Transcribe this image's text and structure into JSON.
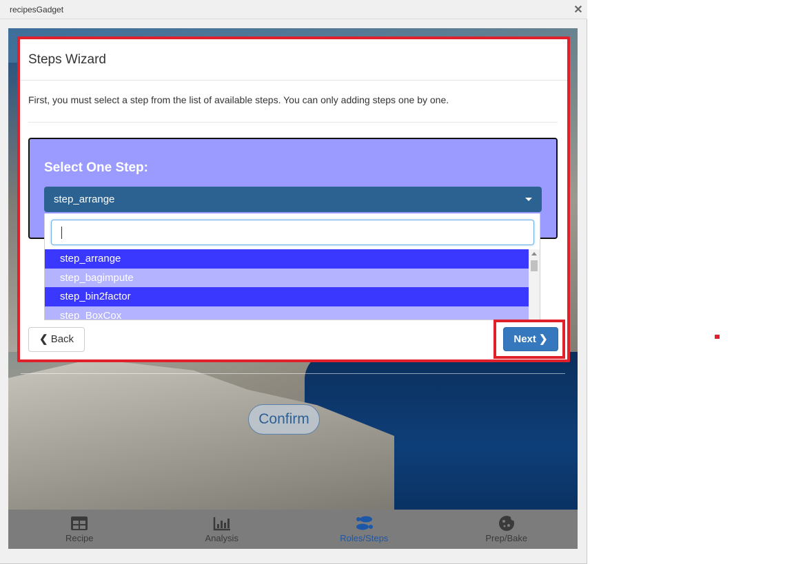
{
  "window": {
    "title": "recipesGadget",
    "close_glyph": "✕"
  },
  "modal": {
    "title": "Steps Wizard",
    "intro": "First, you must select a step from the list of available steps. You can only adding steps one by one.",
    "select_label": "Select One Step:",
    "selected_value": "step_arrange",
    "search_value": "",
    "options": [
      "step_arrange",
      "step_bagimpute",
      "step_bin2factor",
      "step_BoxCox"
    ],
    "back_label": "Back",
    "next_label": "Next"
  },
  "background": {
    "confirm_label": "Confirm"
  },
  "tabs": [
    {
      "label": "Recipe",
      "icon": "table-icon",
      "active": false
    },
    {
      "label": "Analysis",
      "icon": "bar-chart-icon",
      "active": false
    },
    {
      "label": "Roles/Steps",
      "icon": "footsteps-icon",
      "active": true
    },
    {
      "label": "Prep/Bake",
      "icon": "cookie-icon",
      "active": false
    }
  ],
  "colors": {
    "highlight": "#e0202a",
    "panel": "#9b9bff",
    "select": "#2b6291",
    "option_dark": "#3a38ff",
    "option_light": "#b3b3ff",
    "primary": "#3578bd",
    "active_tab": "#1d57a8"
  }
}
